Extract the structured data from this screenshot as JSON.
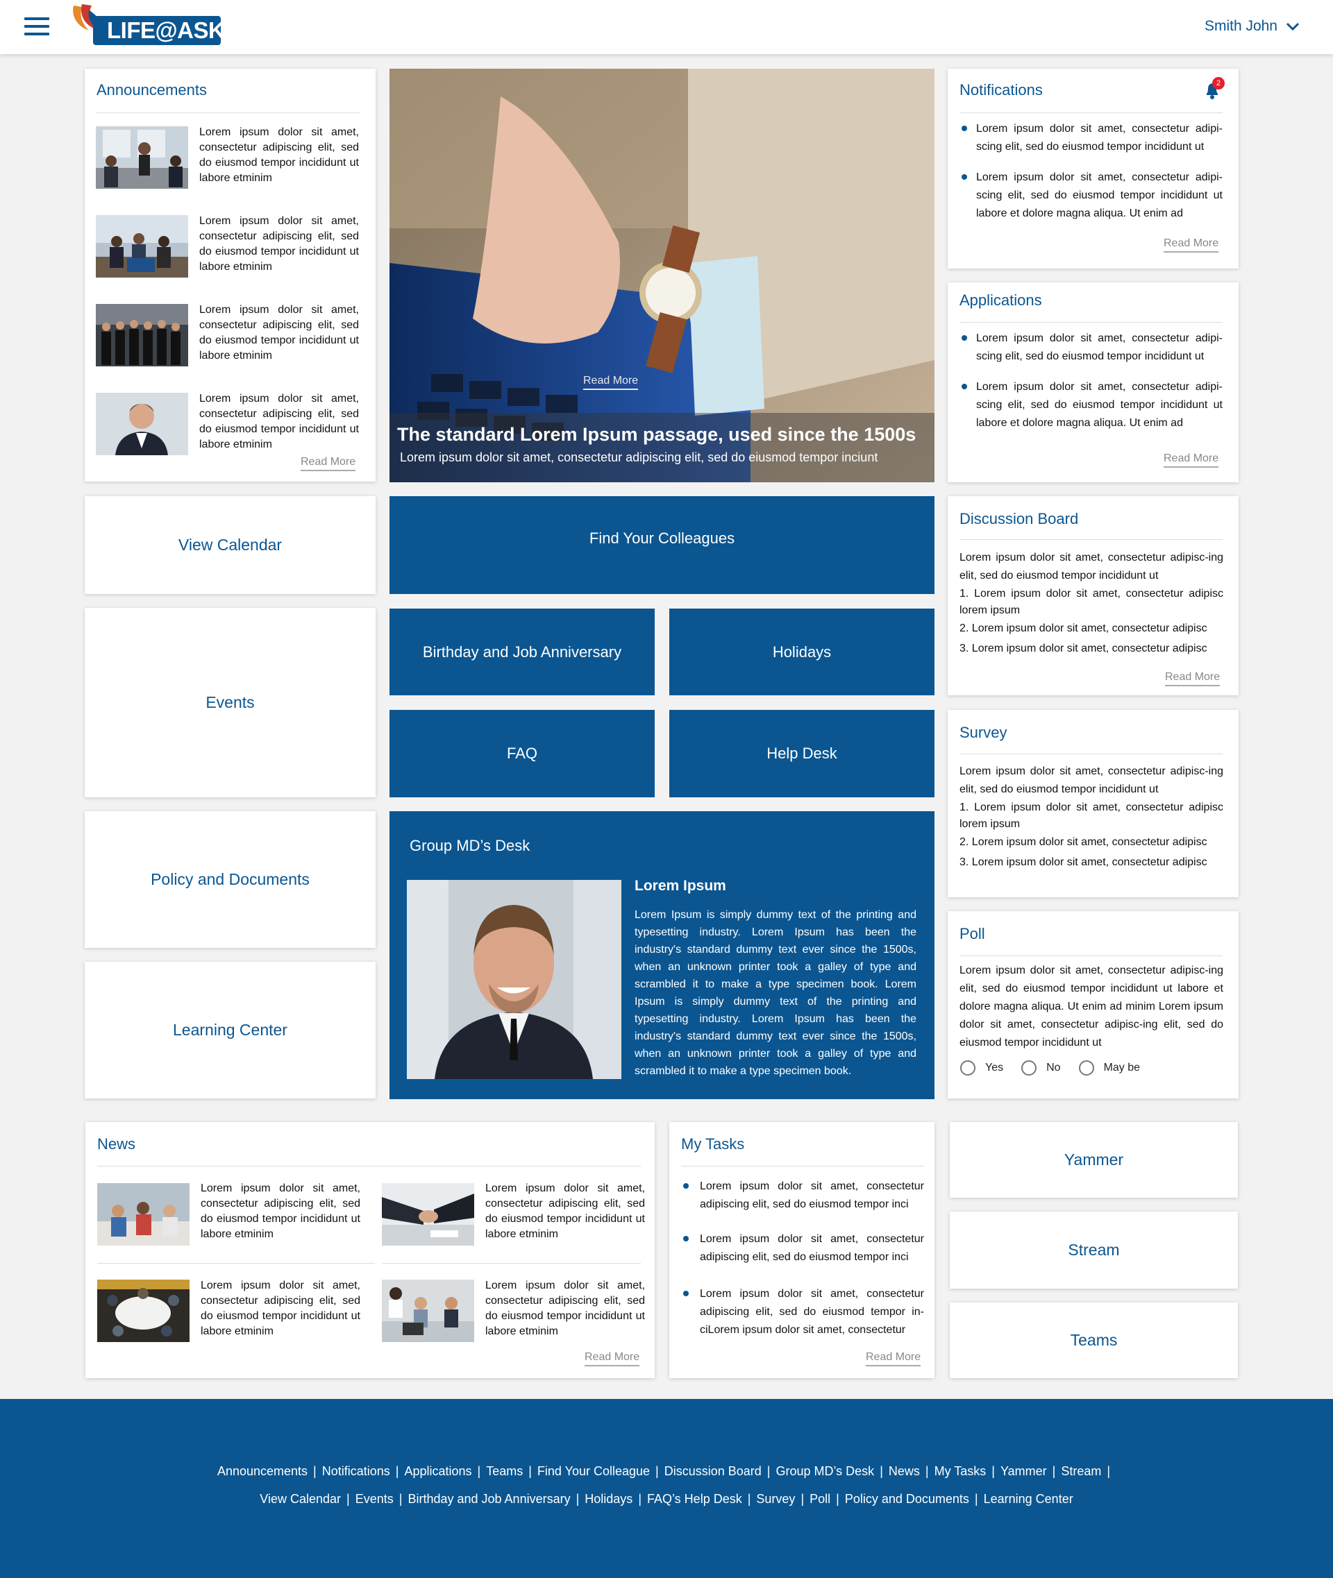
{
  "header": {
    "logo_text": "LIFE@ASK",
    "user_name": "Smith John"
  },
  "announcements": {
    "title": "Announcements",
    "items": [
      {
        "text": "Lorem ipsum dolor sit amet, consectetur adipiscing elit, sed do eiusmod tempor incididunt ut labore etminim"
      },
      {
        "text": "Lorem ipsum dolor sit amet, consectetur adipiscing elit, sed do eiusmod tempor incididunt ut labore etminim"
      },
      {
        "text": "Lorem ipsum dolor sit amet, consectetur adipiscing elit, sed do eiusmod tempor incididunt ut labore etminim"
      },
      {
        "text": "Lorem ipsum dolor sit amet, consectetur adipiscing elit, sed do eiusmod tempor incididunt ut labore etminim"
      }
    ],
    "read_more": "Read More"
  },
  "hero": {
    "read_more": "Read More",
    "title": "The standard Lorem Ipsum passage, used since the 1500s",
    "subtitle": "Lorem ipsum dolor sit amet, consectetur adipiscing elit, sed do eiusmod tempor inciunt"
  },
  "notifications": {
    "title": "Notifications",
    "badge": "2",
    "items": [
      {
        "text": "Lorem ipsum dolor sit amet, consectetur adipi-scing elit, sed do eiusmod tempor incididunt ut"
      },
      {
        "text": "Lorem ipsum dolor sit amet, consectetur adipi-scing elit, sed do eiusmod tempor incididunt ut labore et dolore magna aliqua. Ut enim ad"
      }
    ],
    "read_more": "Read More"
  },
  "applications": {
    "title": "Applications",
    "items": [
      {
        "text": "Lorem ipsum dolor sit amet, consectetur adipi-scing elit, sed do eiusmod tempor incididunt ut"
      },
      {
        "text": "Lorem ipsum dolor sit amet, consectetur adipi-scing elit, sed do eiusmod tempor incididunt ut labore et dolore magna aliqua. Ut enim ad"
      }
    ],
    "read_more": "Read More"
  },
  "tiles": {
    "view_calendar": "View Calendar",
    "events": "Events",
    "policy": "Policy and Documents",
    "learning": "Learning Center",
    "find_colleagues": "Find Your Colleagues",
    "birthday": "Birthday and Job Anniversary",
    "holidays": "Holidays",
    "faq": "FAQ",
    "help_desk": "Help Desk",
    "yammer": "Yammer",
    "stream": "Stream",
    "teams": "Teams"
  },
  "discussion": {
    "title": "Discussion Board",
    "intro": "Lorem ipsum dolor sit amet, consectetur adipisc-ing elit, sed do eiusmod tempor incididunt ut",
    "items": [
      "1. Lorem ipsum dolor sit amet, consectetur adipisc lorem ipsum",
      "2. Lorem ipsum dolor sit amet, consectetur adipisc",
      "3. Lorem ipsum dolor sit amet, consectetur adipisc"
    ],
    "read_more": "Read More"
  },
  "survey": {
    "title": "Survey",
    "intro": "Lorem ipsum dolor sit amet, consectetur adipisc-ing elit, sed do eiusmod tempor incididunt ut",
    "items": [
      "1. Lorem ipsum dolor sit amet, consectetur adipisc lorem ipsum",
      "2. Lorem ipsum dolor sit amet, consectetur adipisc",
      "3. Lorem ipsum dolor sit amet, consectetur adipisc"
    ]
  },
  "poll": {
    "title": "Poll",
    "text": "Lorem ipsum dolor sit amet, consectetur adipisc-ing elit, sed do eiusmod tempor incididunt ut labore et dolore magna aliqua. Ut enim ad minim Lorem ipsum dolor sit amet, consectetur adipisc-ing elit, sed do eiusmod tempor incididunt ut",
    "options": [
      "Yes",
      "No",
      "May be"
    ]
  },
  "md_desk": {
    "title": "Group MD’s Desk",
    "name": "Lorem Ipsum",
    "text": "Lorem Ipsum is simply dummy text of the printing and typesetting industry. Lorem Ipsum has been the industry's standard dummy text ever since the 1500s, when an unknown printer took a galley of type and scrambled it to make a type specimen book. Lorem Ipsum is simply dummy text of the printing and typesetting industry. Lorem Ipsum has been the industry's standard dummy text ever since the 1500s, when an unknown printer took a galley of type and scrambled it to make a type specimen book."
  },
  "news": {
    "title": "News",
    "items": [
      {
        "text": "Lorem ipsum dolor sit amet, consectetur adipiscing elit, sed do eiusmod tempor incididunt ut labore etminim"
      },
      {
        "text": "Lorem ipsum dolor sit amet, consectetur adipiscing elit, sed do eiusmod tempor incididunt ut labore etminim"
      },
      {
        "text": "Lorem ipsum dolor sit amet, consectetur adipiscing elit, sed do eiusmod tempor incididunt ut labore etminim"
      },
      {
        "text": "Lorem ipsum dolor sit amet, consectetur adipiscing elit, sed do eiusmod tempor incididunt ut labore etminim"
      }
    ],
    "read_more": "Read More"
  },
  "tasks": {
    "title": "My Tasks",
    "items": [
      {
        "text": "Lorem ipsum dolor sit amet, consectetur adipiscing elit, sed do eiusmod tempor inci"
      },
      {
        "text": "Lorem ipsum dolor sit amet, consectetur adipiscing elit, sed do eiusmod tempor inci"
      },
      {
        "text": "Lorem ipsum dolor sit amet, consectetur adipiscing elit, sed do eiusmod tempor in-ciLorem ipsum dolor sit amet, consectetur"
      }
    ],
    "read_more": "Read More"
  },
  "footer": {
    "row1": [
      "Announcements",
      "Notifications",
      "Applications",
      "Teams",
      "Find Your Colleague",
      "Discussion Board",
      "Group MD’s Desk",
      "News",
      "My Tasks",
      "Yammer",
      "Stream"
    ],
    "row2": [
      "View Calendar",
      "Events",
      "Birthday and Job Anniversary",
      "Holidays",
      "FAQ’s Help Desk",
      "Survey",
      "Poll",
      "Policy and Documents",
      "Learning Center"
    ]
  },
  "colors": {
    "brand": "#0b5691",
    "badge": "#e3202b"
  }
}
